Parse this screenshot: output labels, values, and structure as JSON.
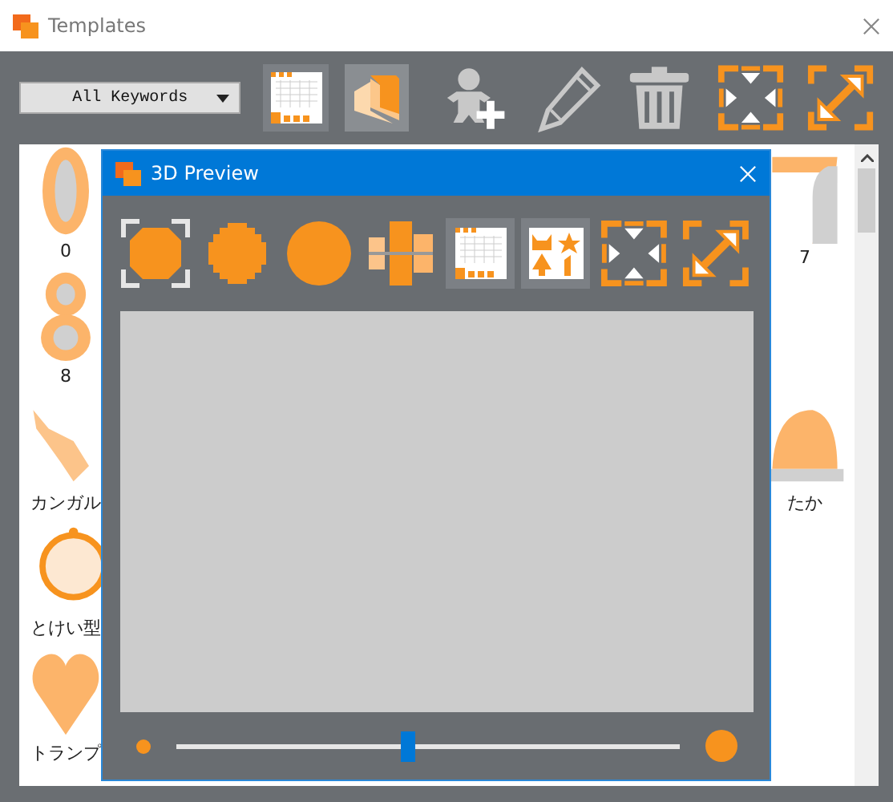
{
  "window": {
    "title": "Templates"
  },
  "toolbar": {
    "keyword_dropdown": {
      "value": "All Keywords"
    }
  },
  "templates": {
    "left_column": [
      {
        "label": "0",
        "kind": "ring"
      },
      {
        "label": "8",
        "kind": "double-ring"
      },
      {
        "label": "カンガル",
        "kind": "animal"
      },
      {
        "label": "とけい型",
        "kind": "clock"
      },
      {
        "label": "トランプ",
        "kind": "heart"
      }
    ],
    "right_column": [
      {
        "label": "7",
        "kind": "arch"
      },
      {
        "label": "たか",
        "kind": "dome"
      }
    ]
  },
  "preview_dialog": {
    "title": "3D Preview",
    "shapes": [
      {
        "kind": "block",
        "selected": true
      },
      {
        "kind": "pixel-circle",
        "selected": false
      },
      {
        "kind": "circle",
        "selected": false
      },
      {
        "kind": "split",
        "selected": false
      }
    ],
    "zoom": {
      "level": 0.46
    }
  }
}
